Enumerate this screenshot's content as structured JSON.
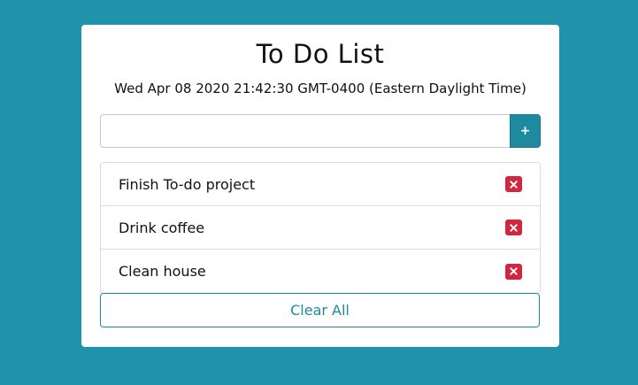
{
  "app": {
    "title": "To Do List",
    "datetime": "Wed Apr 08 2020 21:42:30 GMT-0400 (Eastern Daylight Time)"
  },
  "input": {
    "value": "",
    "placeholder": "",
    "add_label": "+"
  },
  "items": [
    {
      "label": "Finish To-do project",
      "delete_icon": "x-icon"
    },
    {
      "label": "Drink coffee",
      "delete_icon": "x-icon"
    },
    {
      "label": "Clean house",
      "delete_icon": "x-icon"
    }
  ],
  "clear_label": "Clear All",
  "colors": {
    "background": "#1e93aa",
    "accent": "#1e8aa0",
    "delete": "#d0273e"
  }
}
